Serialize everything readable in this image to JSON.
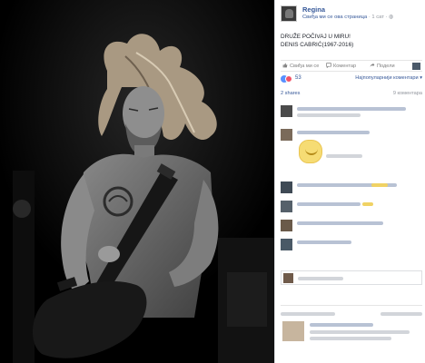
{
  "post": {
    "page_name": "Regina",
    "like_page_label": "Свиђа ми се ова страница",
    "time": "1 сат",
    "text_line1": "DRUŽE POČIVAJ U MIRU!",
    "text_line2": "DENIS CABRIĆ(1967-2016)"
  },
  "actions": {
    "like_label": "Свиђа ми се",
    "comment_label": "Коментар",
    "share_label": "Подели"
  },
  "reactions": {
    "count": "53",
    "sort_label": "Најпопуларнији коментари ▾"
  },
  "stats": {
    "shares": "2 shares",
    "comments": "9 коментара"
  },
  "colors": {
    "link_blue": "#365899",
    "meta_gray": "#90949c",
    "like_blue": "#5890ff",
    "love_red": "#f25268"
  },
  "icons": {
    "like": "thumbs-up-icon",
    "comment": "speech-bubble-icon",
    "share": "share-arrow-icon",
    "globe": "globe-icon"
  }
}
